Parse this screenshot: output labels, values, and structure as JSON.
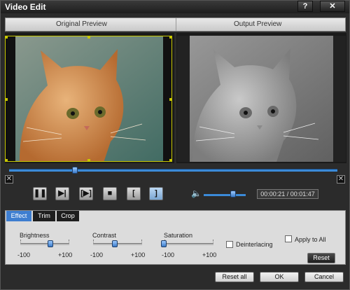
{
  "window": {
    "title": "Video Edit",
    "help_glyph": "?",
    "close_glyph": "✕"
  },
  "preview": {
    "original_label": "Original Preview",
    "output_label": "Output Preview"
  },
  "player": {
    "time": "00:00:21 / 00:01:47",
    "seek_position_pct": 20,
    "volume_pct": 70,
    "buttons": [
      "play-pause",
      "step",
      "clip",
      "stop",
      "mark-in",
      "mark-out"
    ]
  },
  "tabs": [
    "Effect",
    "Trim",
    "Crop"
  ],
  "effect": {
    "brightness": {
      "label": "Brightness",
      "min": "-100",
      "max": "+100",
      "value": 0
    },
    "contrast": {
      "label": "Contrast",
      "min": "-100",
      "max": "+100",
      "value": 0
    },
    "saturation": {
      "label": "Saturation",
      "min": "-100",
      "max": "+100",
      "value": -100
    },
    "deinterlacing_label": "Deinterlacing",
    "apply_all_label": "Apply to All",
    "reset_label": "Reset"
  },
  "footer": {
    "reset_all": "Reset all",
    "ok": "OK",
    "cancel": "Cancel"
  },
  "colors": {
    "accent": "#3b8ad8",
    "crop_frame": "#c8c800"
  }
}
